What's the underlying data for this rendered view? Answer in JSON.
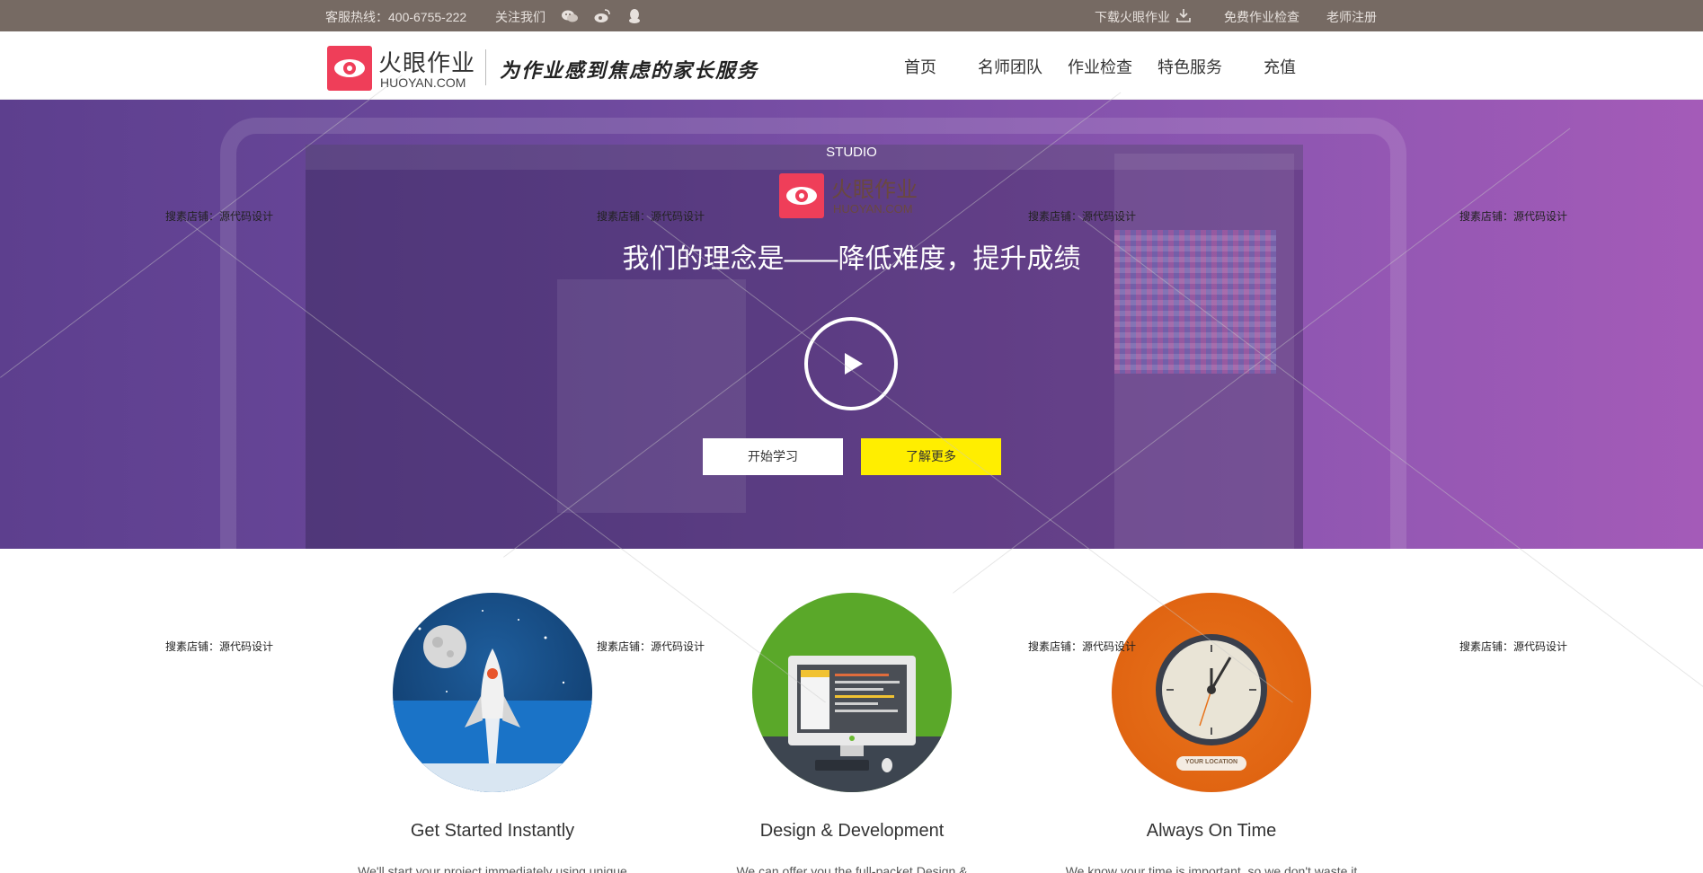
{
  "topbar": {
    "hotline": "客服热线：400-6755-222",
    "follow": "关注我们",
    "download": "下载火眼作业",
    "free_check": "免费作业检查",
    "teacher_register": "老师注册",
    "icons": [
      "wechat-icon",
      "weibo-icon",
      "qq-icon",
      "download-icon"
    ]
  },
  "header": {
    "brand_cn": "火眼作业",
    "brand_en": "HUOYAN.COM",
    "slogan": "为作业感到焦虑的家长服务",
    "nav": [
      "首页",
      "名师团队",
      "作业检查",
      "特色服务",
      "充值"
    ]
  },
  "hero": {
    "studio": "STUDIO",
    "brand_cn": "火眼作业",
    "brand_en": "HUOYAN.COM",
    "title": "我们的理念是——降低难度，提升成绩",
    "btn_start": "开始学习",
    "btn_more": "了解更多",
    "gradient": [
      "#5d3f8e",
      "#a45bb8"
    ]
  },
  "watermark": "搜素店铺：源代码设计",
  "features": [
    {
      "title": "Get Started Instantly",
      "desc": "We'll start your project immediately using unique",
      "icon": "rocket-icon",
      "color": "#144579"
    },
    {
      "title": "Design & Development",
      "desc": "We can offer you the full-packet Design &",
      "icon": "monitor-icon",
      "color": "#5aa829"
    },
    {
      "title": "Always On Time",
      "desc": "We know your time is important, so we don't waste it",
      "icon": "clock-icon",
      "color": "#dd5e0e",
      "badge": "YOUR LOCATION"
    }
  ],
  "colors": {
    "topbar": "#766a63",
    "logo": "#ef3e59",
    "accent_button": "#ffee00"
  }
}
